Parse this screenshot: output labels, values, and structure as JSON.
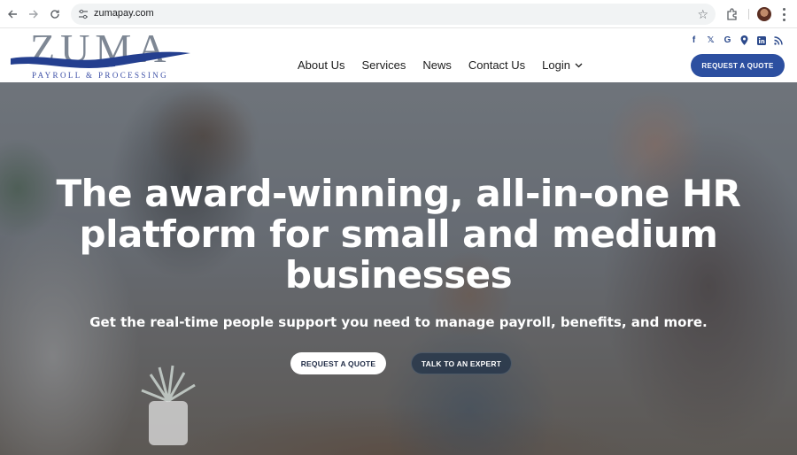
{
  "browser": {
    "url": "zumapay.com",
    "icons": [
      "back-arrow-icon",
      "forward-arrow-icon",
      "reload-icon",
      "site-settings-icon",
      "bookmark-star-icon",
      "extensions-icon",
      "profile-avatar",
      "more-menu-icon"
    ]
  },
  "header": {
    "logo_tagline": "PAYROLL & PROCESSING",
    "nav": [
      "About Us",
      "Services",
      "News",
      "Contact Us"
    ],
    "login_label": "Login",
    "cta_label": "REQUEST A QUOTE",
    "social_icons": [
      "facebook-icon",
      "x-icon",
      "google-icon",
      "location-icon",
      "linkedin-icon",
      "rss-icon"
    ],
    "colors": {
      "brand_blue": "#2c4fa0",
      "nav_text": "#1d1d1d"
    }
  },
  "hero": {
    "title": "The award-winning, all-in-one HR platform for small and medium businesses",
    "subtitle": "Get the real-time people support you need to manage payroll, benefits, and more.",
    "primary_button": "REQUEST A QUOTE",
    "secondary_button": "TALK TO AN EXPERT"
  }
}
